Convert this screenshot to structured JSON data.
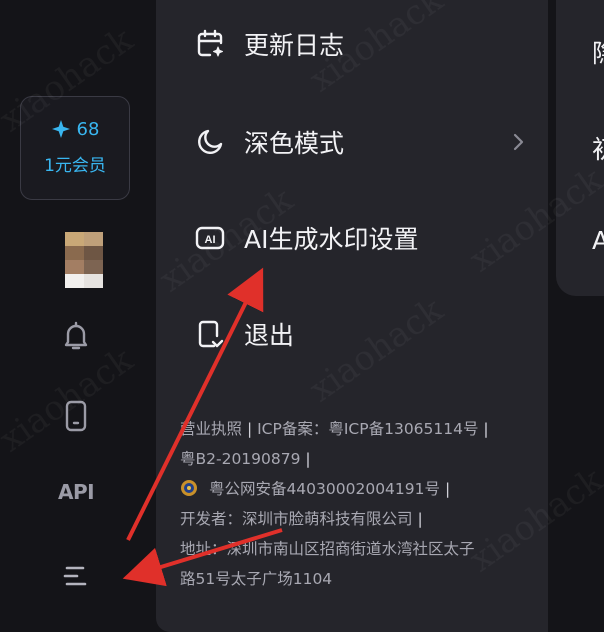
{
  "rail": {
    "credits_count": "68",
    "member_label": "1元会员",
    "api_label": "API"
  },
  "menu": {
    "items": [
      {
        "label": "更新日志",
        "icon": "calendar-sparkle-icon"
      },
      {
        "label": "深色模式",
        "icon": "moon-icon",
        "has_chevron": true
      },
      {
        "label": "AI生成水印设置",
        "icon": "ai-badge-icon"
      },
      {
        "label": "退出",
        "icon": "logout-icon"
      }
    ]
  },
  "footer": {
    "line1": "营业执照",
    "line1_icp": "ICP备案：粤ICP备13065114号",
    "line2": "粤B2-20190879",
    "line3": "粤公网安备44030002004191号",
    "line4": "开发者：深圳市脸萌科技有限公司",
    "line5": "地址：深圳市南山区招商街道水湾社区太子",
    "line6": "路51号太子广场1104"
  },
  "right_peek": {
    "items": [
      "隐",
      "初",
      "A"
    ]
  },
  "colors": {
    "accent": "#39b6f0",
    "annotation_arrow": "#e0302a",
    "panel_bg": "#25252b",
    "page_bg": "#141418"
  }
}
